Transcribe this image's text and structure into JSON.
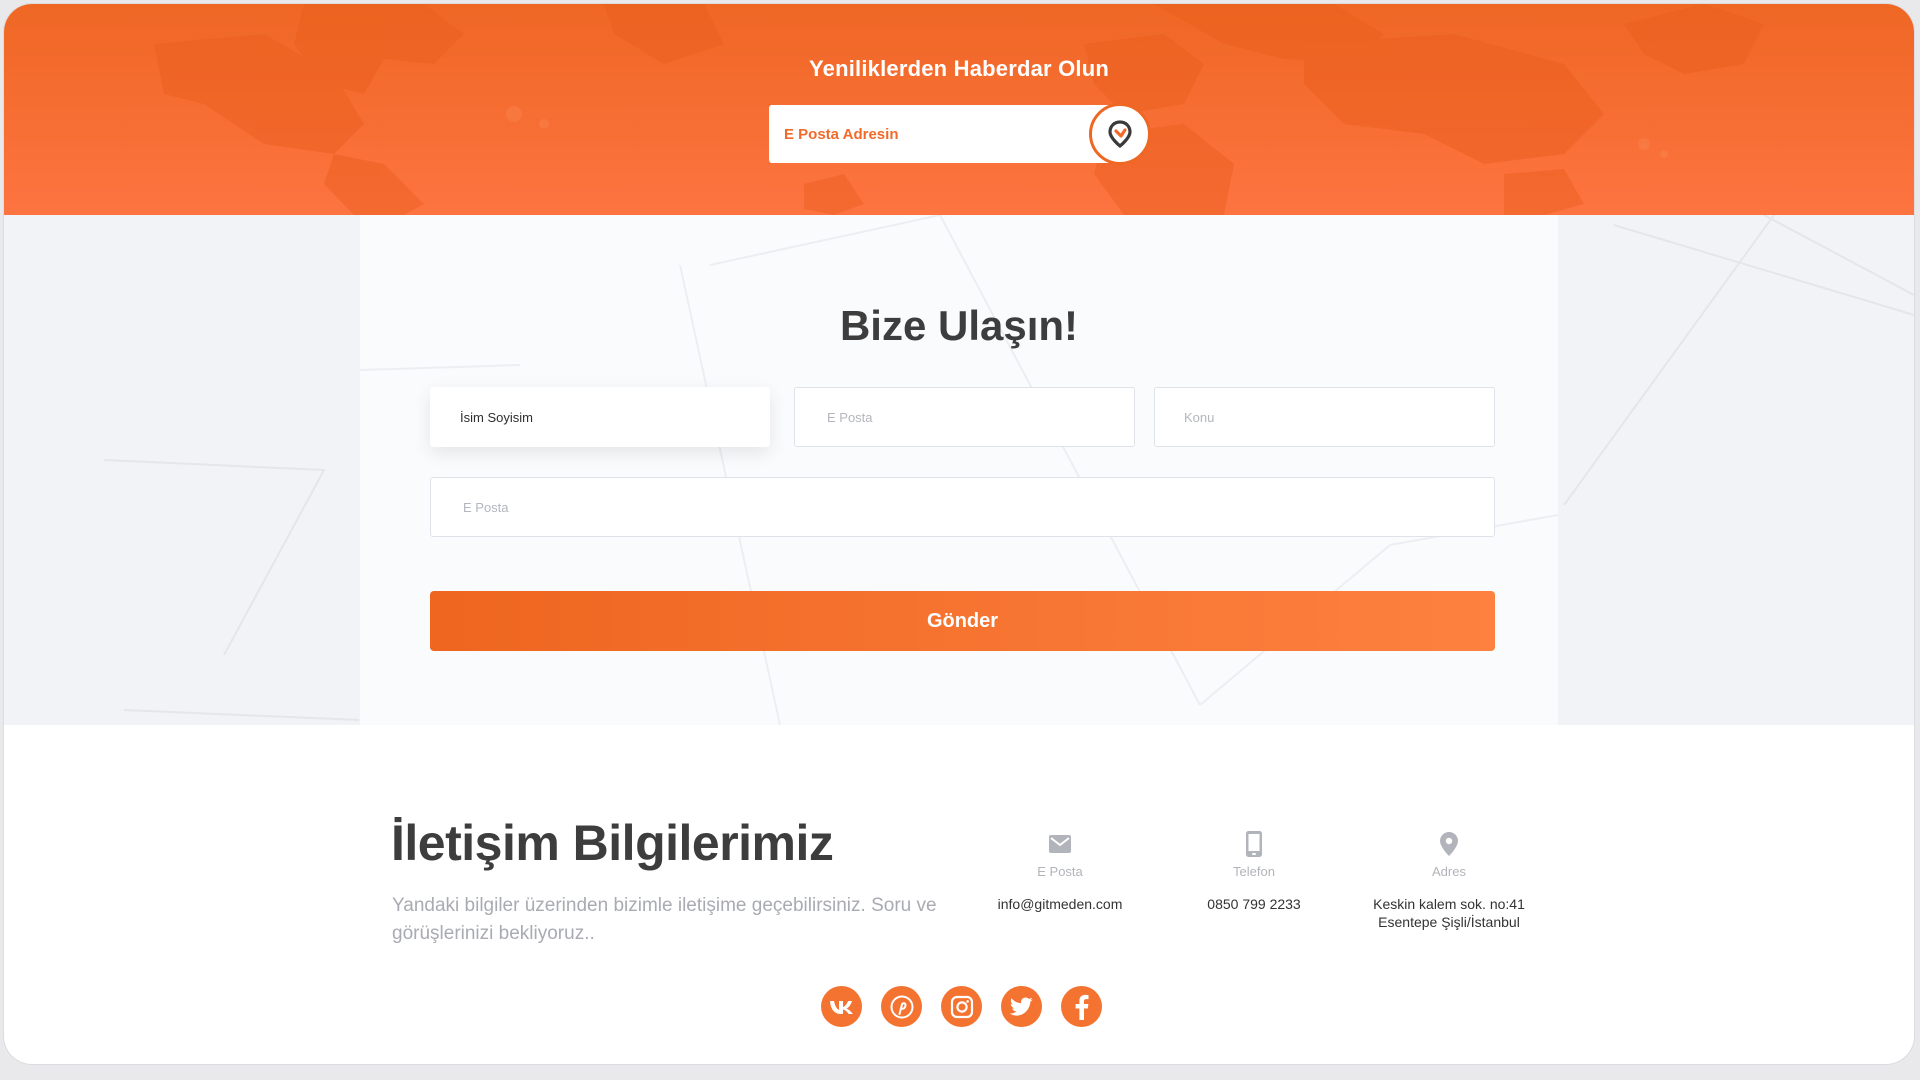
{
  "colors": {
    "accent": "#f26a2a",
    "accent_light": "#fe8140",
    "heading": "#3d3d3d",
    "muted": "#a9abb2",
    "section_bg": "#f2f3f6"
  },
  "newsletter": {
    "title": "Yeniliklerden Haberdar Olun",
    "email_placeholder": "E Posta Adresin",
    "submit_icon": "location-pin-arrow-icon"
  },
  "contact_form": {
    "title": "Bize Ulaşın!",
    "name_placeholder": "İsim Soyisim",
    "email_placeholder": "E Posta",
    "subject_placeholder": "Konu",
    "message_placeholder": "E Posta",
    "submit_label": "Gönder"
  },
  "contact_info": {
    "title": "İletişim Bilgilerimiz",
    "description": "Yandaki bilgiler üzerinden bizimle iletişime geçebilirsiniz. Soru ve görüşlerinizi bekliyoruz..",
    "items": [
      {
        "icon": "mail-icon",
        "label": "E Posta",
        "value": "info@gitmeden.com"
      },
      {
        "icon": "phone-icon",
        "label": "Telefon",
        "value": "0850 799 2233"
      },
      {
        "icon": "location-icon",
        "label": "Adres",
        "line1": "Keskin kalem sok. no:41",
        "line2": "Esentepe Şişli/İstanbul"
      }
    ]
  },
  "socials": [
    {
      "icon": "vk-icon"
    },
    {
      "icon": "pinterest-icon"
    },
    {
      "icon": "instagram-icon"
    },
    {
      "icon": "twitter-icon"
    },
    {
      "icon": "facebook-icon"
    }
  ]
}
